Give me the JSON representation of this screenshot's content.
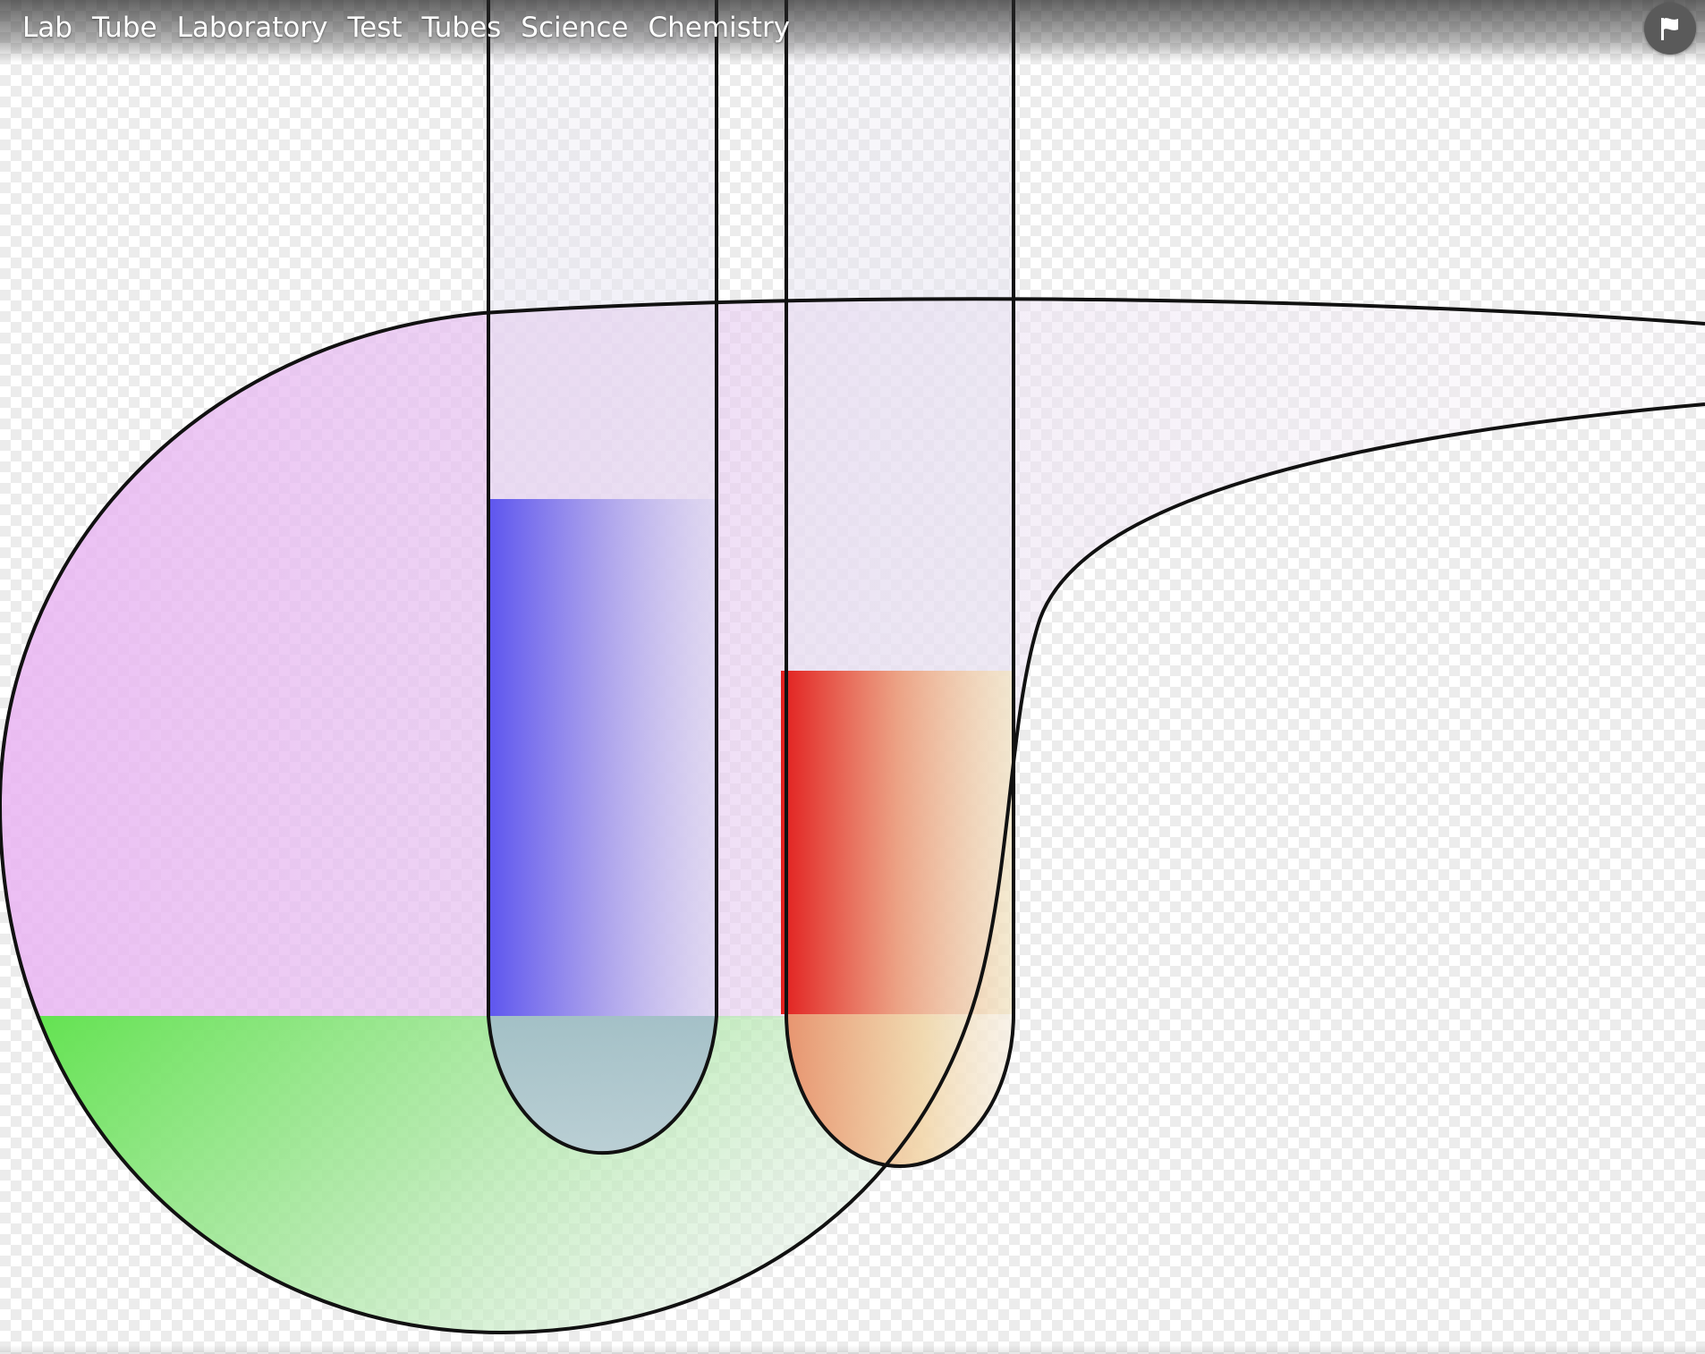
{
  "image_viewer": {
    "tags": [
      "Lab",
      "Tube",
      "Laboratory",
      "Test",
      "Tubes",
      "Science",
      "Chemistry"
    ],
    "report_button_icon": "flag-icon"
  },
  "artwork": {
    "subject": "test tubes in a flask",
    "colors": {
      "flask_liquid_top": "#e9b3f2",
      "flask_liquid_bottom": "#5de24a",
      "left_tube_liquid": "#6058ee",
      "right_tube_liquid": "#e21e1e",
      "right_tube_liquid_fade": "#f2cf86",
      "outline": "#111111"
    }
  }
}
